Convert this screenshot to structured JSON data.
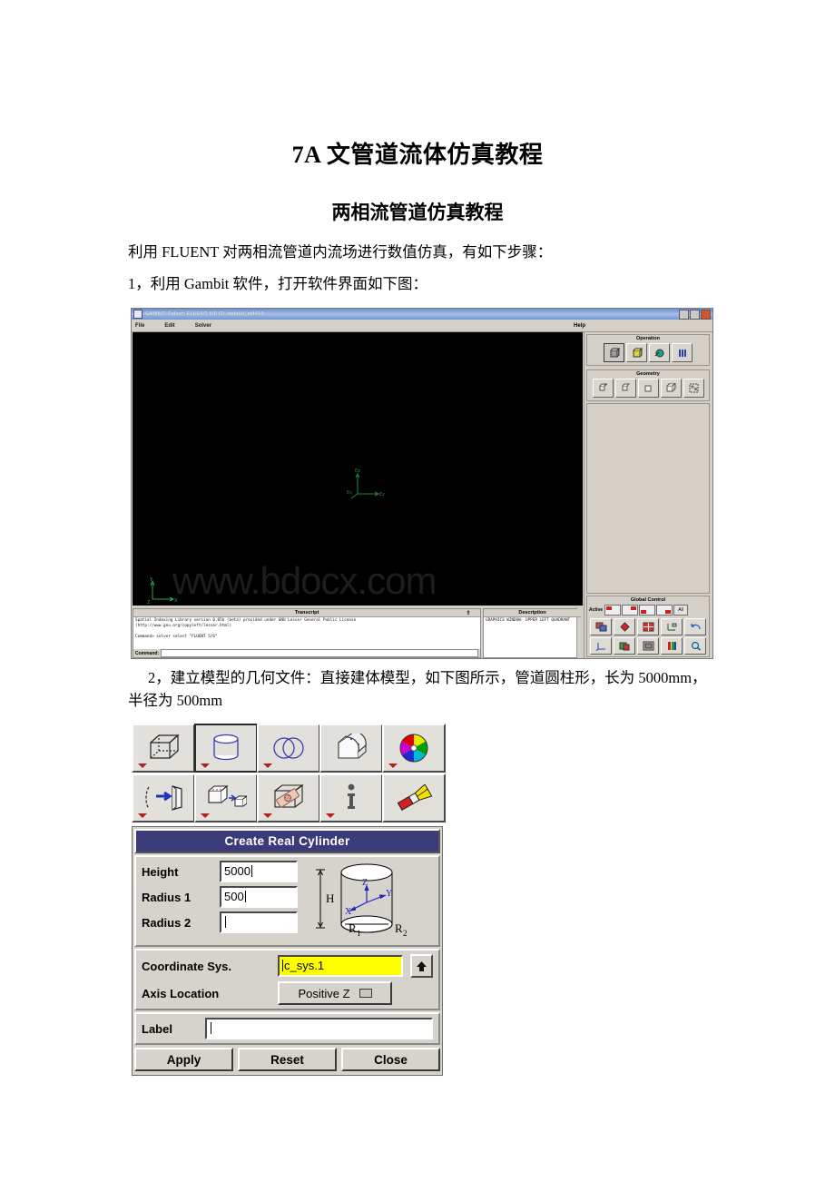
{
  "document": {
    "title": "7A 文管道流体仿真教程",
    "subtitle": "两相流管道仿真教程",
    "para1": "利用 FLUENT 对两相流管道内流场进行数值仿真，有如下步骤：",
    "para2": "1，利用 Gambit 软件，打开软件界面如下图：",
    "para3": "2，建立模型的几何文件：直接建体模型，如下图所示，管道圆柱形，长为 5000mm，半径为 500mm"
  },
  "gambit": {
    "title": "GAMBIT      Solver: FLUENT 5/6     ID: default_id4410",
    "menus": [
      "File",
      "Edit",
      "Solver"
    ],
    "help_label": "Help",
    "watermark": "www.bdocx.com",
    "canvas_triad_labels": [
      "Z",
      "X",
      "Y"
    ],
    "corner_triad_labels": [
      "Y",
      "Z",
      "X"
    ],
    "transcript": {
      "header": "Transcript",
      "lines": [
        "Spatial Indexing Library version 0.05b (beta) provided under GNU Lesser General Public License",
        "(http://www.gnu.org/copyleft/lesser.html)",
        "",
        "Command> solver select \"FLUENT 5/6\""
      ],
      "command_label": "Command:",
      "command_value": ""
    },
    "description": {
      "header": "Description",
      "text": "GRAPHICS WINDOW- UPPER LEFT QUADRANT"
    },
    "dock": {
      "operation_header": "Operation",
      "operation_icons": [
        "geometry-operation-icon",
        "mesh-operation-icon",
        "zones-operation-icon",
        "tools-operation-icon"
      ],
      "geometry_header": "Geometry",
      "geometry_icons": [
        "vertex-icon",
        "edge-icon",
        "face-icon",
        "volume-icon",
        "group-icon"
      ],
      "global_control_header": "Global Control",
      "active_label": "Active",
      "active_quadrants": [
        "quad-upper-left",
        "quad-upper-right",
        "quad-lower-left",
        "quad-lower-right"
      ],
      "all_label": "All",
      "control_icons": [
        "graphics-window-icon",
        "orient-model-icon",
        "window-layout-icon",
        "axis-icon",
        "undo-icon",
        "coordinate-icon",
        "render-icon",
        "reset-view-icon",
        "color-icon",
        "zoom-icon"
      ]
    }
  },
  "toolbar": {
    "icons": [
      {
        "name": "create-brick-icon",
        "has_arrow": true,
        "selected": false
      },
      {
        "name": "create-cylinder-icon",
        "has_arrow": true,
        "selected": true
      },
      {
        "name": "boolean-operation-icon",
        "has_arrow": true,
        "selected": false
      },
      {
        "name": "split-volume-icon",
        "has_arrow": false,
        "selected": false
      },
      {
        "name": "color-wheel-icon",
        "has_arrow": true,
        "selected": false
      },
      {
        "name": "move-copy-volume-icon",
        "has_arrow": true,
        "selected": false
      },
      {
        "name": "sweep-volume-icon",
        "has_arrow": true,
        "selected": false
      },
      {
        "name": "connect-volume-icon",
        "has_arrow": true,
        "selected": false
      },
      {
        "name": "volume-info-icon",
        "has_arrow": true,
        "selected": false
      },
      {
        "name": "delete-volume-icon",
        "has_arrow": false,
        "selected": false
      }
    ]
  },
  "dialog": {
    "title": "Create Real Cylinder",
    "fields": {
      "height_label": "Height",
      "height_value": "5000",
      "radius1_label": "Radius 1",
      "radius1_value": "500",
      "radius2_label": "Radius 2",
      "radius2_value": "",
      "coord_label": "Coordinate Sys.",
      "coord_value": "c_sys.1",
      "axis_label": "Axis Location",
      "axis_value": "Positive Z",
      "name_label": "Label",
      "name_value": ""
    },
    "diagram": {
      "height_mark": "H",
      "r1_mark": "R",
      "r1_sub": "1",
      "r2_mark": "R",
      "r2_sub": "2",
      "axes": [
        "Z",
        "Y",
        "X"
      ]
    },
    "buttons": {
      "apply": "Apply",
      "reset": "Reset",
      "close": "Close"
    }
  },
  "colors": {
    "dialog_title_bg": "#3b3b7a",
    "highlight_field": "#ffff00",
    "window_chrome": "#d4d0c8",
    "canvas_bg": "#000000",
    "triad_green": "#1f8a3a"
  }
}
